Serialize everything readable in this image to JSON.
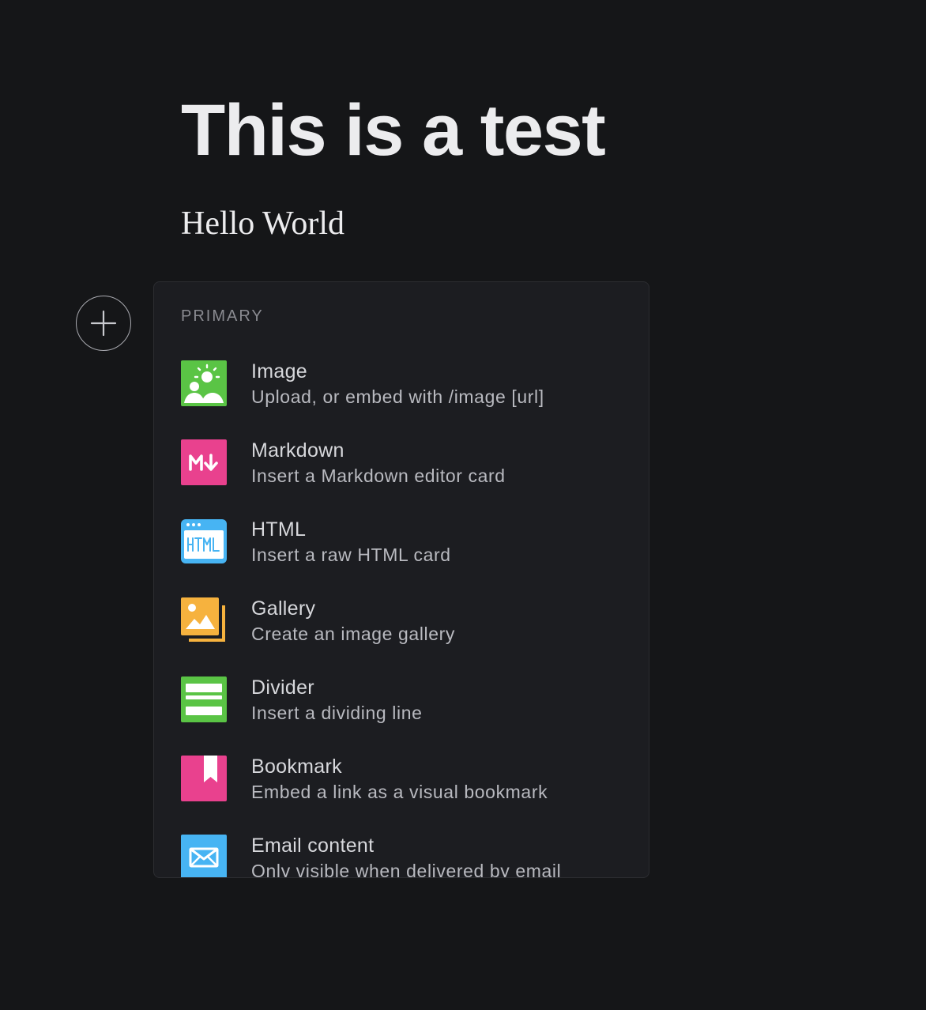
{
  "editor": {
    "title": "This is a test",
    "body": "Hello World"
  },
  "card_menu": {
    "add_button_icon": "plus-icon",
    "section_label": "PRIMARY",
    "items": [
      {
        "title": "Image",
        "description": "Upload, or embed with /image [url]",
        "icon": "image-icon",
        "color": "#5ac445"
      },
      {
        "title": "Markdown",
        "description": "Insert a Markdown editor card",
        "icon": "markdown-icon",
        "color": "#e9418e"
      },
      {
        "title": "HTML",
        "description": "Insert a raw HTML card",
        "icon": "html-icon",
        "color": "#47b4f3"
      },
      {
        "title": "Gallery",
        "description": "Create an image gallery",
        "icon": "gallery-icon",
        "color": "#f6b23e"
      },
      {
        "title": "Divider",
        "description": "Insert a dividing line",
        "icon": "divider-icon",
        "color": "#5ac445"
      },
      {
        "title": "Bookmark",
        "description": "Embed a link as a visual bookmark",
        "icon": "bookmark-icon",
        "color": "#e9418e"
      },
      {
        "title": "Email content",
        "description": "Only visible when delivered by email",
        "icon": "email-icon",
        "color": "#47b4f3"
      }
    ]
  }
}
